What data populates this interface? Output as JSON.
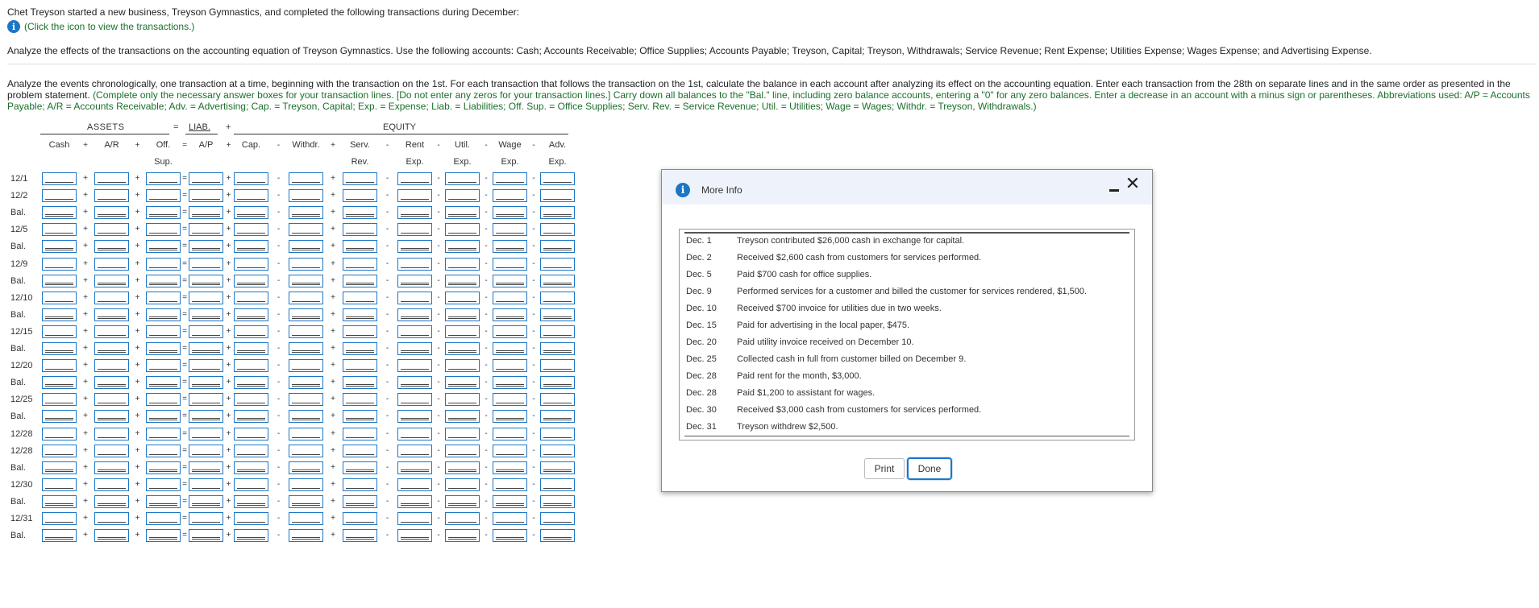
{
  "intro": "Chet Treyson started a new business, Treyson Gymnastics, and completed the following transactions during December:",
  "info_link": "(Click the icon to view the transactions.)",
  "analyze": "Analyze the effects of the transactions on the accounting equation of Treyson Gymnastics. Use the following accounts: Cash; Accounts Receivable; Office Supplies; Accounts Payable; Treyson, Capital; Treyson, Withdrawals; Service Revenue; Rent Expense; Utilities Expense; Wages Expense; and Advertising Expense.",
  "instructions": {
    "main": "Analyze the events chronologically, one transaction at a time, beginning with the transaction on the 1st. For each transaction that follows the transaction on the 1st, calculate the balance in each account after analyzing its effect on the accounting equation. Enter each transaction from the 28th on separate lines and in the same order as presented in the problem statement.",
    "green": "(Complete only the necessary answer boxes for your transaction lines. [Do not enter any zeros for your transaction lines.] Carry down all balances to the \"Bal.\" line, including zero balance accounts, entering a \"0\" for any zero balances. Enter a decrease in an account with a minus sign or parentheses. Abbreviations used: A/P = Accounts Payable; A/R = Accounts Receivable; Adv. = Advertising; Cap. = Treyson, Capital; Exp. = Expense; Liab. = Liabilities; Off. Sup. = Office Supplies; Serv. Rev. = Service Revenue; Util. = Utilities; Wage = Wages; Withdr. = Treyson, Withdrawals.)"
  },
  "table": {
    "group_assets": "ASSETS",
    "group_liab": "LIAB.",
    "group_equity": "EQUITY",
    "eq_sign": "=",
    "plus_sign": "+",
    "columns": [
      {
        "l1": "Cash",
        "l2": ""
      },
      {
        "l1": "A/R",
        "l2": ""
      },
      {
        "l1": "Off.",
        "l2": "Sup."
      },
      {
        "l1": "A/P",
        "l2": ""
      },
      {
        "l1": "Cap.",
        "l2": ""
      },
      {
        "l1": "Withdr.",
        "l2": ""
      },
      {
        "l1": "Serv.",
        "l2": "Rev."
      },
      {
        "l1": "Rent",
        "l2": "Exp."
      },
      {
        "l1": "Util.",
        "l2": "Exp."
      },
      {
        "l1": "Wage",
        "l2": "Exp."
      },
      {
        "l1": "Adv.",
        "l2": "Exp."
      }
    ],
    "header_ops": [
      "+",
      "+",
      "=",
      "+",
      "-",
      "+",
      "-",
      "-",
      "-",
      "-"
    ],
    "cell_ops": [
      "+",
      "+",
      "=",
      "+",
      "-",
      "+",
      "-",
      "-",
      "-",
      "-"
    ],
    "rows": [
      "12/1",
      "12/2",
      "Bal.",
      "12/5",
      "Bal.",
      "12/9",
      "Bal.",
      "12/10",
      "Bal.",
      "12/15",
      "Bal.",
      "12/20",
      "Bal.",
      "12/25",
      "Bal.",
      "12/28",
      "12/28",
      "Bal.",
      "12/30",
      "Bal.",
      "12/31",
      "Bal."
    ]
  },
  "modal": {
    "title": "More Info",
    "minimize_icon": "minimize-icon",
    "close_icon": "close-icon",
    "close_glyph": "✕",
    "info_glyph": "i",
    "transactions": [
      {
        "date": "Dec. 1",
        "text": "Treyson contributed $26,000 cash in exchange for capital."
      },
      {
        "date": "Dec. 2",
        "text": "Received $2,600 cash from customers for services performed."
      },
      {
        "date": "Dec. 5",
        "text": "Paid $700 cash for office supplies."
      },
      {
        "date": "Dec. 9",
        "text": "Performed services for a customer and billed the customer for services rendered, $1,500."
      },
      {
        "date": "Dec. 10",
        "text": "Received $700 invoice for utilities due in two weeks."
      },
      {
        "date": "Dec. 15",
        "text": "Paid for advertising in the local paper, $475."
      },
      {
        "date": "Dec. 20",
        "text": "Paid utility invoice received on December 10."
      },
      {
        "date": "Dec. 25",
        "text": "Collected cash in full from customer billed on December 9."
      },
      {
        "date": "Dec. 28",
        "text": "Paid rent for the month, $3,000."
      },
      {
        "date": "Dec. 28",
        "text": "Paid $1,200 to assistant for wages."
      },
      {
        "date": "Dec. 30",
        "text": "Received $3,000 cash from customers for services performed."
      },
      {
        "date": "Dec. 31",
        "text": "Treyson withdrew $2,500."
      }
    ],
    "print_label": "Print",
    "done_label": "Done"
  },
  "colors": {
    "accent": "#1c76c6",
    "instruction_green": "#1a6f2a"
  }
}
